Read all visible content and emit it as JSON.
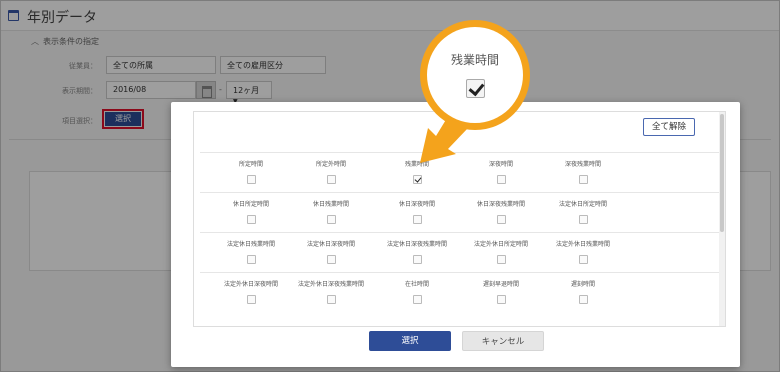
{
  "header": {
    "title": "年別データ"
  },
  "filter": {
    "toggle_label": "表示条件の指定",
    "org_label": "従業員：",
    "org_value": "全ての所属",
    "emp_value": "全ての雇用区分",
    "period_label": "表示期間：",
    "period_value": "2016/08",
    "sep": "-",
    "months_value": "12ヶ月",
    "items_label": "項目選択：",
    "select_button": "選択"
  },
  "modal": {
    "clear_all": "全て解除",
    "ok_button": "選択",
    "cancel_button": "キャンセル",
    "rows": [
      [
        {
          "label": "所定時間",
          "checked": false
        },
        {
          "label": "所定外時間",
          "checked": false
        },
        {
          "label": "残業時間",
          "checked": true
        },
        {
          "label": "深夜時間",
          "checked": false
        },
        {
          "label": "深夜残業時間",
          "checked": false
        }
      ],
      [
        {
          "label": "休日所定時間",
          "checked": false
        },
        {
          "label": "休日残業時間",
          "checked": false
        },
        {
          "label": "休日深夜時間",
          "checked": false
        },
        {
          "label": "休日深夜残業時間",
          "checked": false
        },
        {
          "label": "法定休日所定時間",
          "checked": false
        }
      ],
      [
        {
          "label": "法定休日残業時間",
          "checked": false
        },
        {
          "label": "法定休日深夜時間",
          "checked": false
        },
        {
          "label": "法定休日深夜残業時間",
          "checked": false
        },
        {
          "label": "法定外休日所定時間",
          "checked": false
        },
        {
          "label": "法定外休日残業時間",
          "checked": false
        }
      ],
      [
        {
          "label": "法定外休日深夜時間",
          "checked": false
        },
        {
          "label": "法定外休日深夜残業時間",
          "checked": false
        },
        {
          "label": "在社時間",
          "checked": false
        },
        {
          "label": "遅刻早退時間",
          "checked": false
        },
        {
          "label": "遅刻時間",
          "checked": false
        }
      ]
    ]
  },
  "callout": {
    "label": "残業時間",
    "checked": true
  },
  "colors": {
    "accent": "#2e4d97",
    "highlight": "#e0102a",
    "callout": "#f4a31c"
  }
}
